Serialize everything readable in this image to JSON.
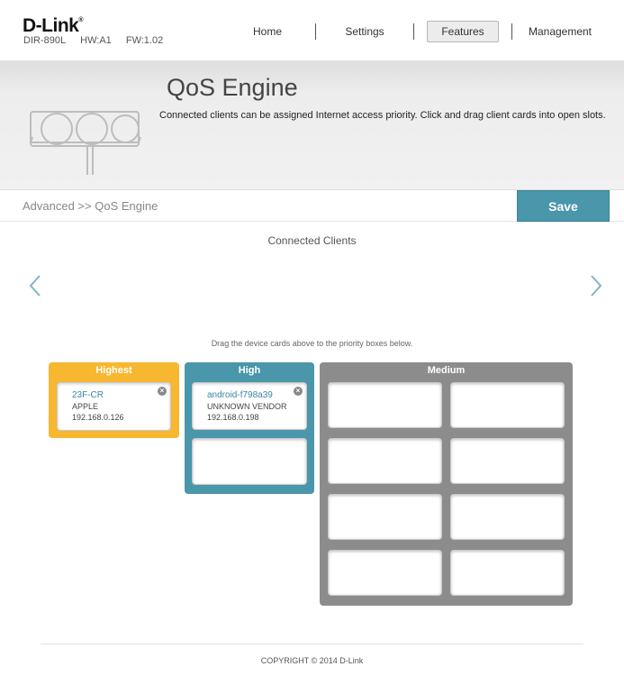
{
  "header": {
    "brand": "D-Link",
    "brand_mark": "®",
    "model": "DIR-890L",
    "hw": "HW:A1",
    "fw": "FW:1.02",
    "nav": [
      {
        "label": "Home"
      },
      {
        "label": "Settings"
      },
      {
        "label": "Features",
        "active": true
      },
      {
        "label": "Management"
      }
    ]
  },
  "banner": {
    "title": "QoS Engine",
    "description": "Connected clients can be assigned Internet access priority. Click and drag client cards into open slots.",
    "image_icon": "traffic-light-icon"
  },
  "breadcrumb": {
    "path": "Advanced >> QoS Engine",
    "save_label": "Save"
  },
  "clients": {
    "title": "Connected Clients",
    "prev_icon": "chevron-left-icon",
    "next_icon": "chevron-right-icon",
    "hint": "Drag the device cards above to the priority boxes below."
  },
  "priorities": {
    "highest": {
      "label": "Highest",
      "color": "#f7b731",
      "cards": [
        {
          "name": "23F-CR",
          "vendor": "APPLE",
          "ip": "192.168.0.126"
        }
      ]
    },
    "high": {
      "label": "High",
      "color": "#4a96ab",
      "cards": [
        {
          "name": "android-f798a39",
          "vendor": "UNKNOWN VENDOR",
          "ip": "192.168.0.198"
        }
      ]
    },
    "medium": {
      "label": "Medium",
      "color": "#8c8c8c",
      "slots": 8
    }
  },
  "footer": {
    "copyright": "COPYRIGHT © 2014 D-Link"
  }
}
